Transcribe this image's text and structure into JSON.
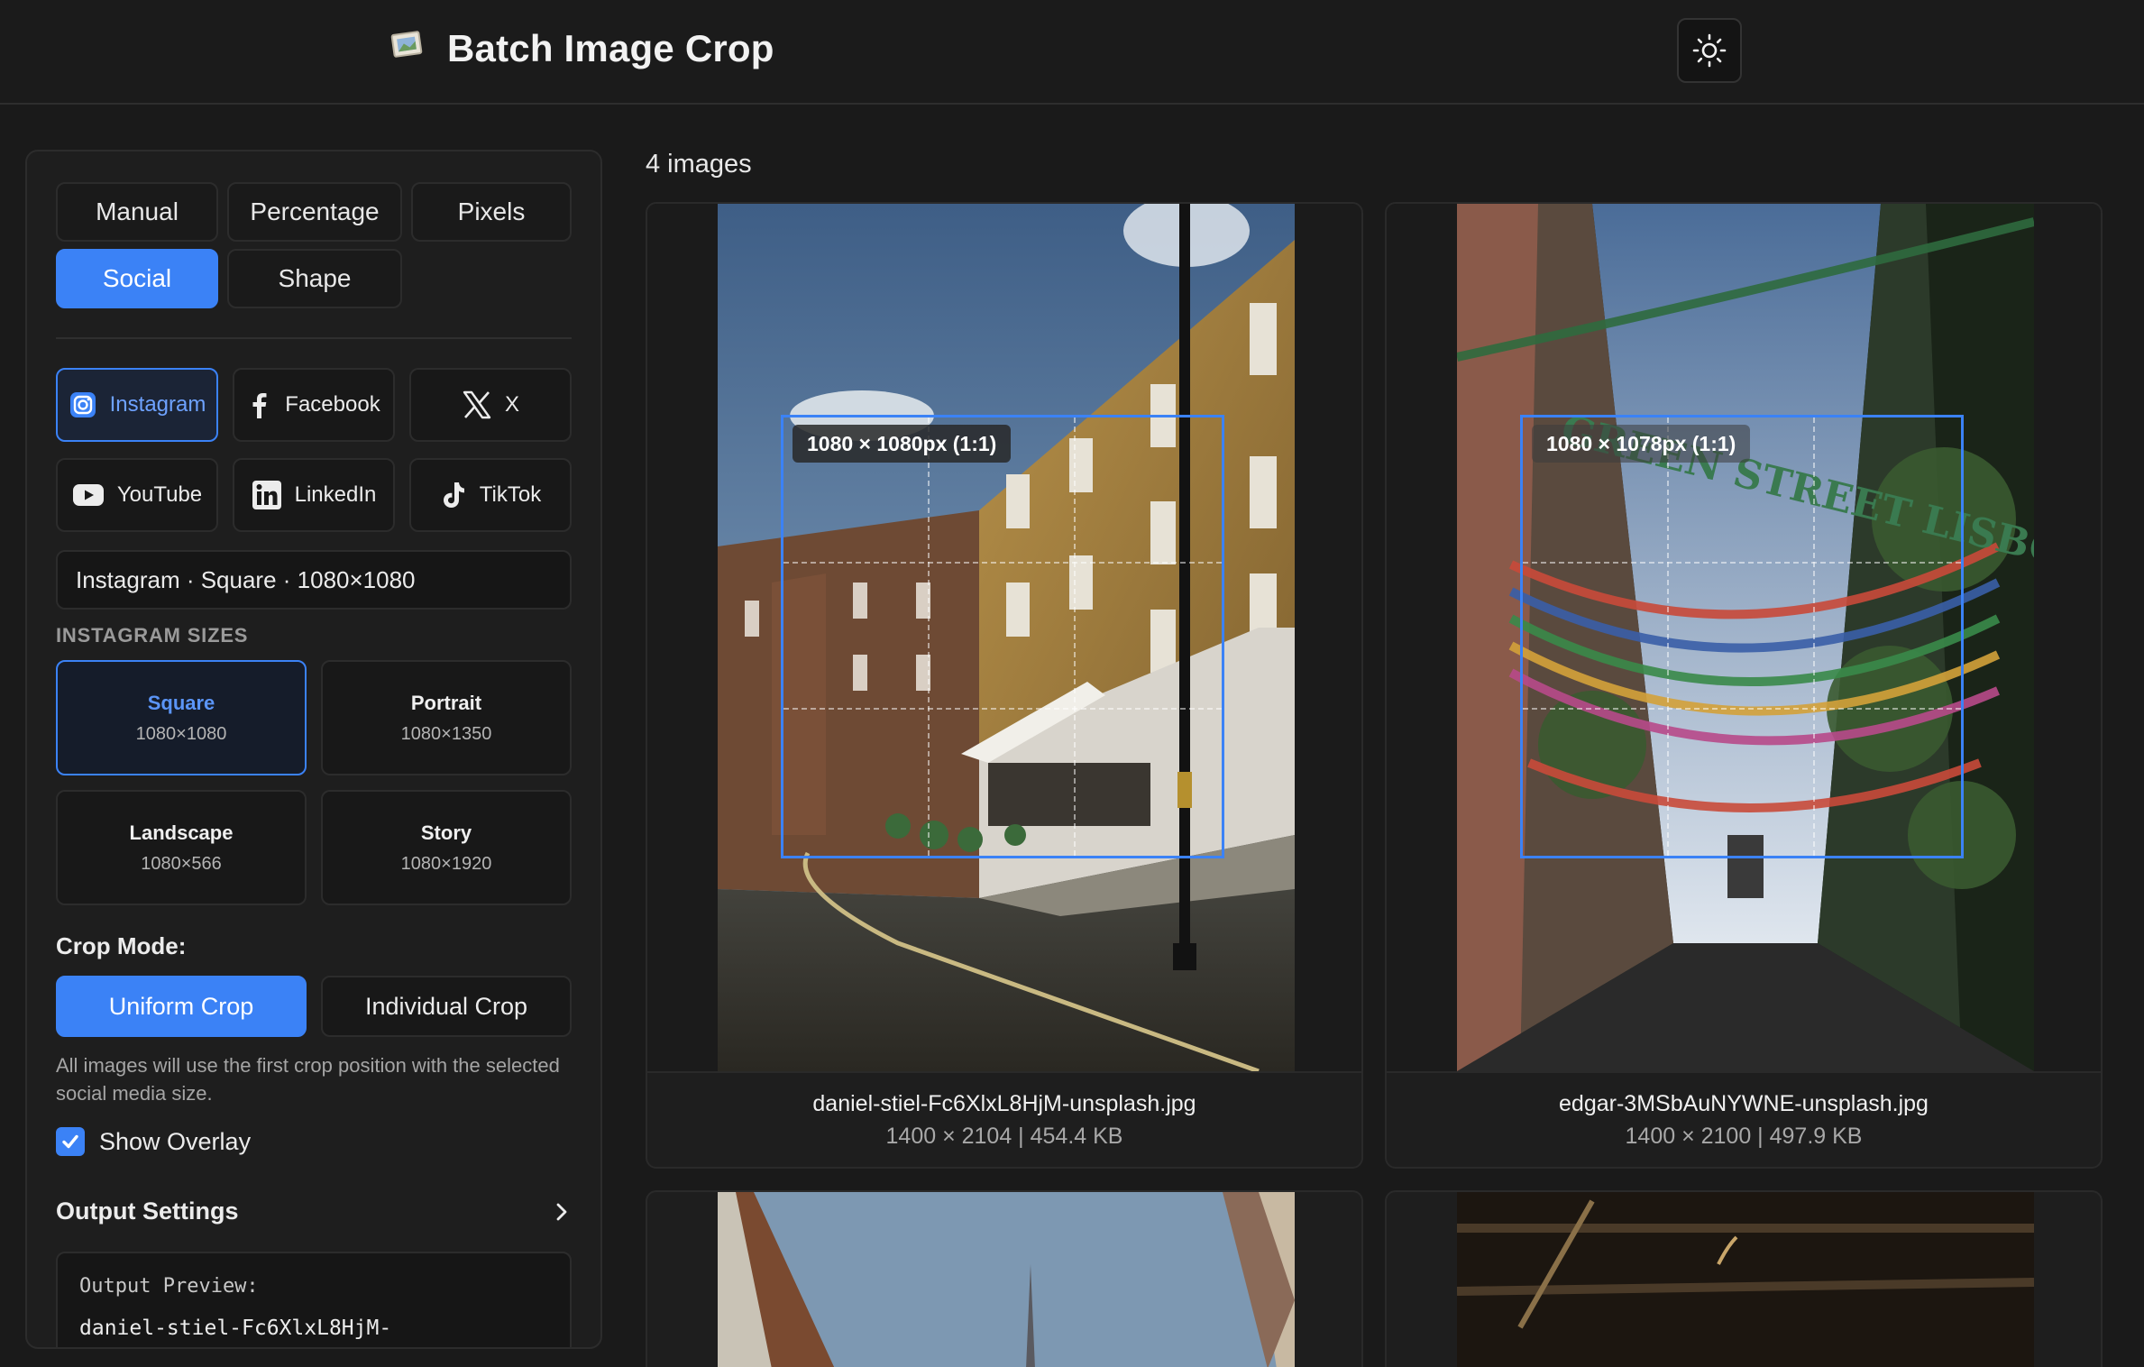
{
  "header": {
    "title": "Batch Image Crop",
    "logo_icon": "picture-frame-icon",
    "theme_icon": "sun-icon"
  },
  "sidebar": {
    "crop_tabs": [
      {
        "label": "Manual",
        "active": false
      },
      {
        "label": "Percentage",
        "active": false
      },
      {
        "label": "Pixels",
        "active": false
      },
      {
        "label": "Social",
        "active": true
      },
      {
        "label": "Shape",
        "active": false
      }
    ],
    "platforms": [
      {
        "label": "Instagram",
        "icon": "instagram-icon",
        "active": true
      },
      {
        "label": "Facebook",
        "icon": "facebook-icon",
        "active": false
      },
      {
        "label": "X",
        "icon": "x-icon",
        "active": false
      },
      {
        "label": "YouTube",
        "icon": "youtube-icon",
        "active": false
      },
      {
        "label": "LinkedIn",
        "icon": "linkedin-icon",
        "active": false
      },
      {
        "label": "TikTok",
        "icon": "tiktok-icon",
        "active": false
      }
    ],
    "selection_summary": "Instagram · Square · 1080×1080",
    "sizes_heading": "INSTAGRAM SIZES",
    "sizes": [
      {
        "name": "Square",
        "dims": "1080×1080",
        "active": true
      },
      {
        "name": "Portrait",
        "dims": "1080×1350",
        "active": false
      },
      {
        "name": "Landscape",
        "dims": "1080×566",
        "active": false
      },
      {
        "name": "Story",
        "dims": "1080×1920",
        "active": false
      }
    ],
    "crop_mode_label": "Crop Mode:",
    "crop_modes": [
      {
        "label": "Uniform Crop",
        "active": true
      },
      {
        "label": "Individual Crop",
        "active": false
      }
    ],
    "crop_mode_help": "All images will use the first crop position with the selected social media size.",
    "show_overlay_label": "Show Overlay",
    "show_overlay_checked": true,
    "output_settings_label": "Output Settings",
    "output_preview_label": "Output Preview:",
    "output_preview_value": "daniel-stiel-Fc6XlxL8HjM-"
  },
  "gallery": {
    "count_label": "4 images",
    "images": [
      {
        "filename": "daniel-stiel-Fc6XlxL8HjM-unsplash.jpg",
        "meta": "1400 × 2104 | 454.4 KB",
        "crop_label": "1080 × 1080px (1:1)"
      },
      {
        "filename": "edgar-3MSbAuNYWNE-unsplash.jpg",
        "meta": "1400 × 2100 | 497.9 KB",
        "crop_label": "1080 × 1078px (1:1)"
      }
    ]
  },
  "colors": {
    "accent": "#3b82f6",
    "background": "#1a1a1a",
    "panel": "#1e1e1e"
  }
}
